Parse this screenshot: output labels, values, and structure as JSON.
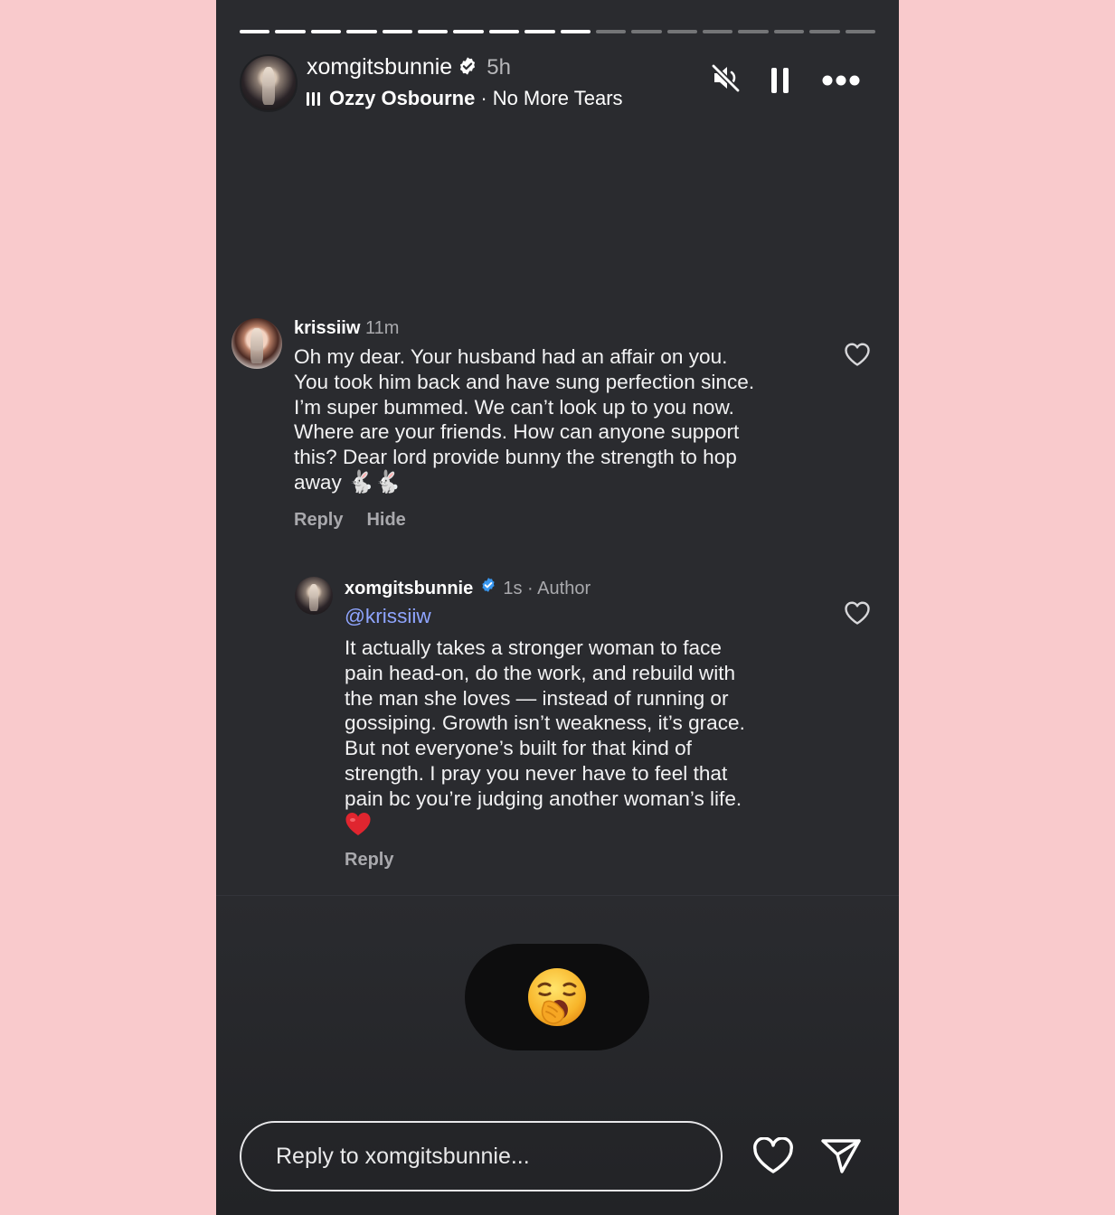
{
  "story": {
    "progress": {
      "segments_total": 18,
      "segments_done": 10
    },
    "header": {
      "username": "xomgitsbunnie",
      "time": "5h",
      "music_artist": "Ozzy Osbourne",
      "music_separator": "·",
      "music_song": "No More Tears",
      "icons": [
        "muted-speaker-icon",
        "pause-icon",
        "more-options-icon"
      ]
    }
  },
  "comments": [
    {
      "username": "krissiiw",
      "time": "11m",
      "lines": [
        "Oh my dear. Your husband had an affair on you.",
        "You took him back and have sung perfection since.",
        "I’m super bummed. We can’t look up to you now.",
        "Where are your friends. How can anyone support",
        "this? Dear lord provide bunny the strength to hop",
        "away"
      ],
      "emoji": "🐇🐇",
      "reply_label": "Reply",
      "hide_label": "Hide"
    },
    {
      "username": "xomgitsbunnie",
      "time": "1s",
      "separator": "·",
      "author_label": "Author",
      "mention": "@krissiiw",
      "lines": [
        "It actually takes a stronger woman to face",
        "pain head-on, do the work, and rebuild with",
        "the man she loves — instead of running or",
        "gossiping. Growth isn’t weakness, it’s grace.",
        "But not everyone’s built for that kind of",
        "strength. I pray you never have to feel that",
        "pain bc you’re judging another woman’s life."
      ],
      "emoji": "❤️",
      "reply_label": "Reply"
    }
  ],
  "reaction": {
    "emoji_name": "yawning-face"
  },
  "footer": {
    "reply_placeholder": "Reply to xomgitsbunnie...",
    "icons": [
      "heart-icon",
      "send-icon"
    ]
  },
  "colors": {
    "page_background": "#f9cacc",
    "story_background": "#2a2b2f",
    "verified_blue": "#3897f0",
    "mention_blue": "#8fa5ff",
    "heart_red": "#e0252f"
  }
}
